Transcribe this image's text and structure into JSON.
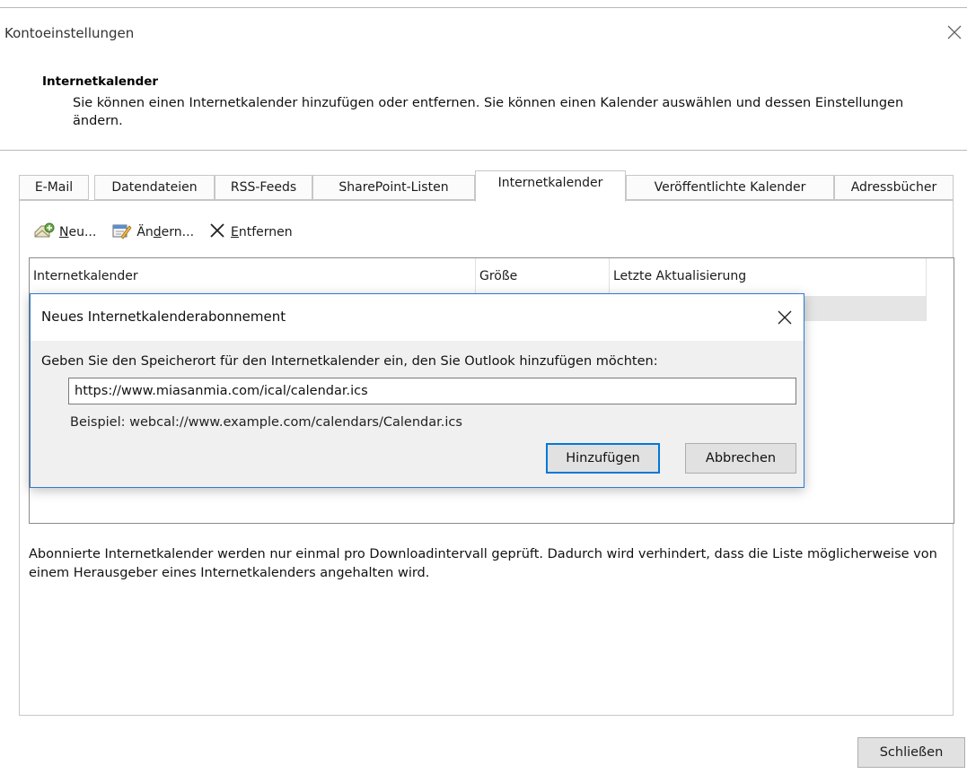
{
  "window": {
    "title": "Kontoeinstellungen"
  },
  "header": {
    "title": "Internetkalender",
    "description": "Sie können einen Internetkalender hinzufügen oder entfernen. Sie können einen Kalender auswählen und dessen Einstellungen ändern."
  },
  "tabs": [
    {
      "label": "E-Mail"
    },
    {
      "label": "Datendateien"
    },
    {
      "label": "RSS-Feeds"
    },
    {
      "label": "SharePoint-Listen"
    },
    {
      "label": "Internetkalender",
      "active": true
    },
    {
      "label": "Veröffentlichte Kalender"
    },
    {
      "label": "Adressbücher"
    }
  ],
  "toolbar": {
    "new": {
      "pre": "",
      "key": "N",
      "post": "eu..."
    },
    "change": {
      "pre": "Än",
      "key": "d",
      "post": "ern..."
    },
    "remove": {
      "pre": "",
      "key": "E",
      "post": "ntfernen"
    }
  },
  "list": {
    "columns": [
      "Internetkalender",
      "Größe",
      "Letzte Aktualisierung"
    ]
  },
  "footer_note": "Abonnierte Internetkalender werden nur einmal pro Downloadintervall geprüft. Dadurch wird verhindert, dass die Liste möglicherweise von einem Herausgeber eines Internetkalenders angehalten wird.",
  "close_button": "Schließen",
  "dialog": {
    "title": "Neues Internetkalenderabonnement",
    "prompt": "Geben Sie den Speicherort für den Internetkalender ein, den Sie Outlook hinzufügen möchten:",
    "url_value": "https://www.miasanmia.com/ical/calendar.ics",
    "example": "Beispiel: webcal://www.example.com/calendars/Calendar.ics",
    "add_button": "Hinzufügen",
    "cancel_button": "Abbrechen"
  },
  "colors": {
    "accent": "#0078d7",
    "dialog_border": "#2b7cd3",
    "button_face": "#e1e1e1"
  }
}
